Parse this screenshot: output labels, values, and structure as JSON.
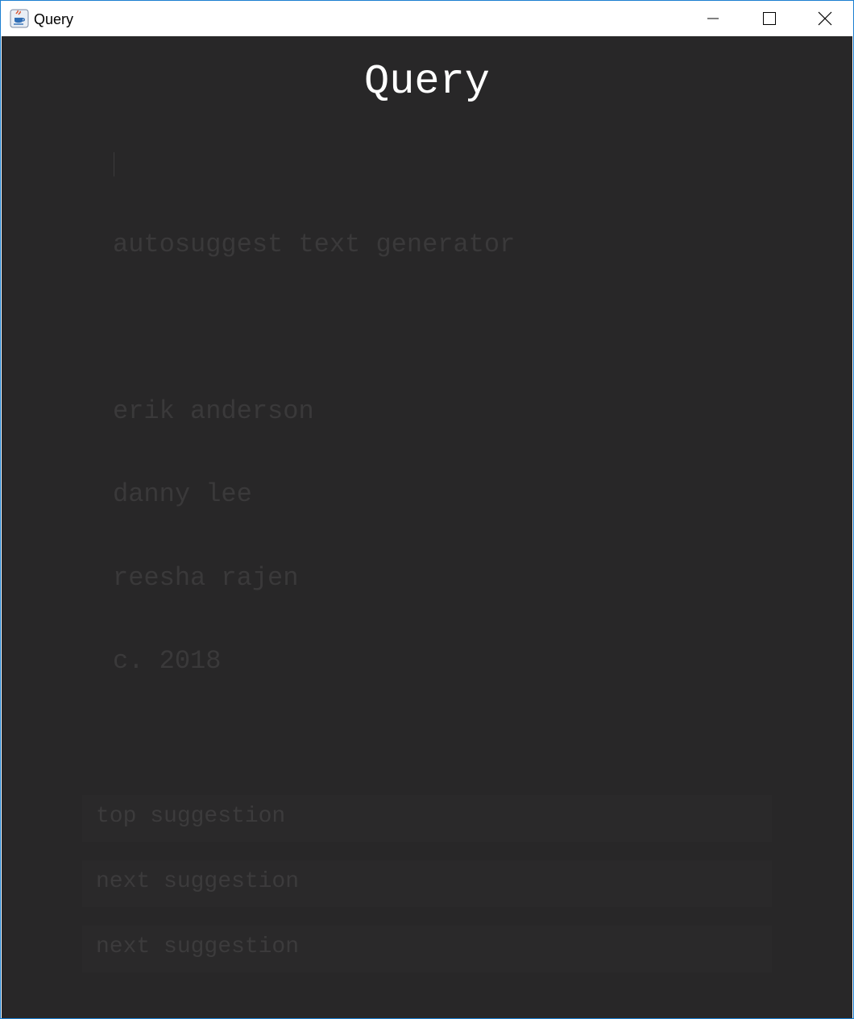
{
  "window": {
    "title": "Query",
    "icon": "java-cup-icon",
    "controls": [
      "minimize-icon",
      "maximize-icon",
      "close-icon"
    ]
  },
  "app": {
    "heading": "Query",
    "text_area": {
      "lines": [
        "autosuggest text generator",
        "",
        "erik anderson",
        "danny lee",
        "reesha rajen",
        "c. 2018"
      ]
    },
    "suggestions": [
      "top suggestion",
      "next suggestion",
      "next suggestion"
    ]
  },
  "colors": {
    "background": "#282728",
    "heading": "#ffffff",
    "muted_text": "#3a393a",
    "suggestion_bg": "#2a292a",
    "window_border": "#1b7fd1"
  }
}
